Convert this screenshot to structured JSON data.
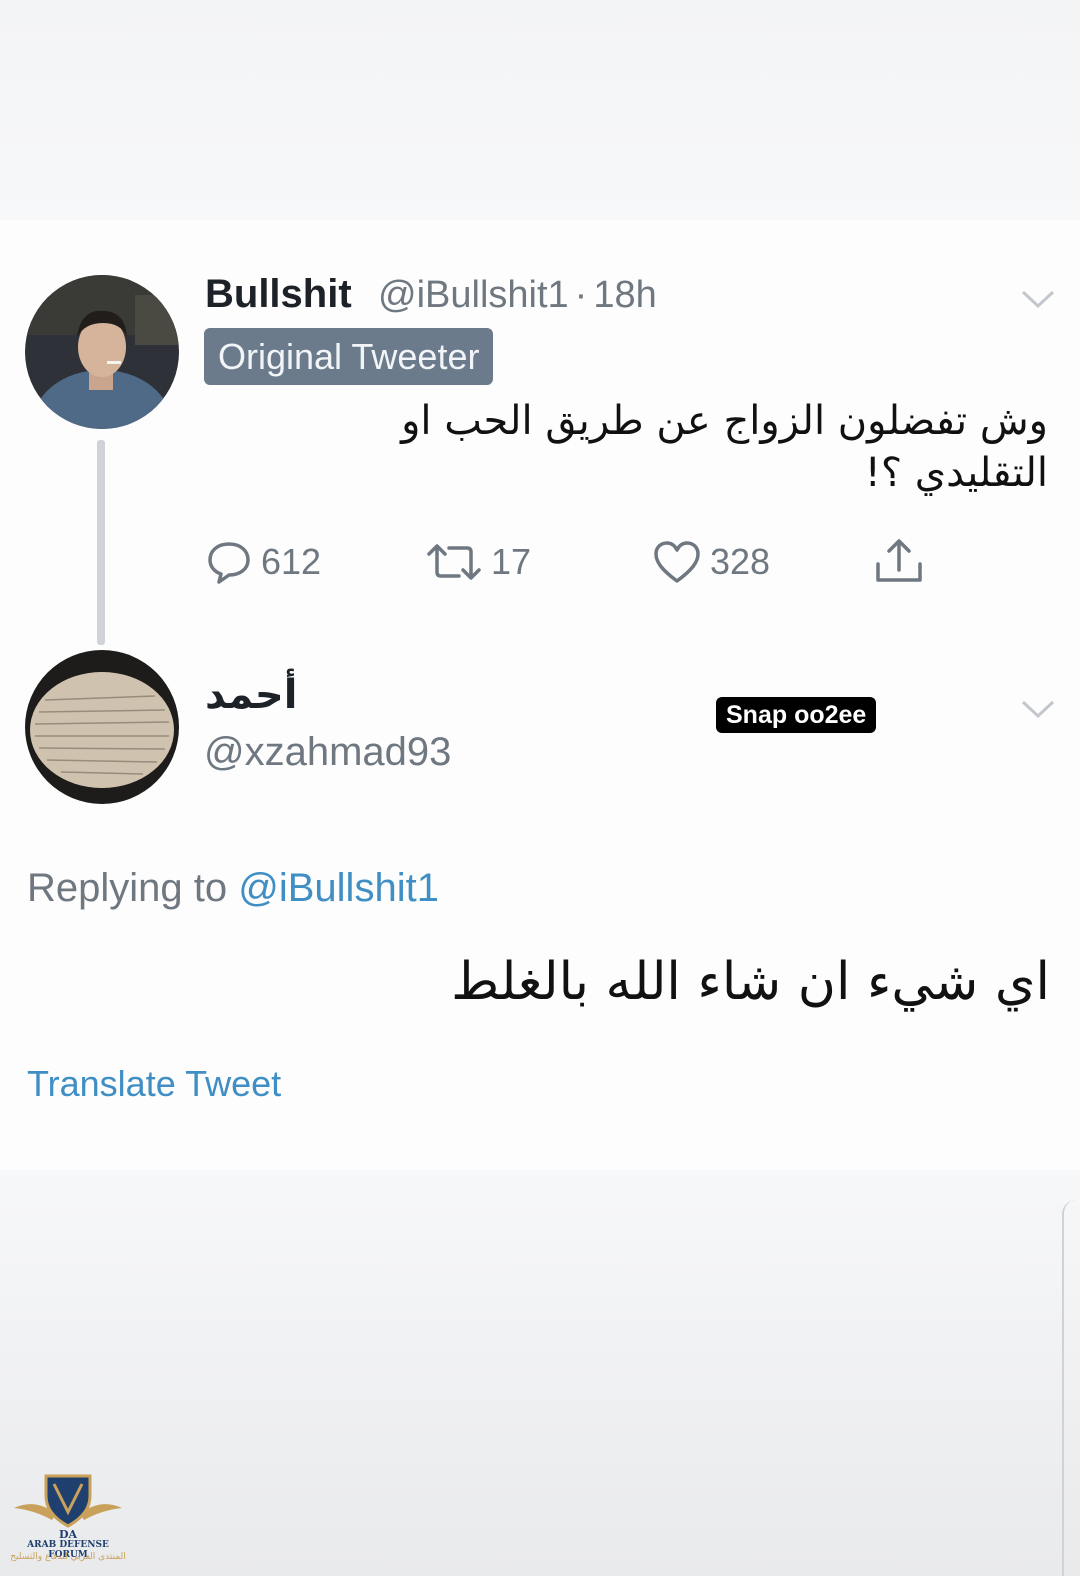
{
  "tweet1": {
    "display_name": "Bullshit",
    "handle": "@iBullshit1",
    "separator": "·",
    "time": "18h",
    "badge": "Original Tweeter",
    "text": "وش تفضلون الزواج عن طريق الحب او التقليدي ؟!",
    "replies": "612",
    "retweets": "17",
    "likes": "328"
  },
  "tweet2": {
    "display_name": "أحمد",
    "handle": "@xzahmad93",
    "overlay_sticker": "Snap oo2ee",
    "replying_label": "Replying to",
    "replying_mention": "@iBullshit1",
    "text": "اي شيء ان شاء الله بالغلط",
    "translate_label": "Translate Tweet"
  },
  "watermark": {
    "title": "ARAB DEFENSE FORUM",
    "subtitle": "المنتدى العربي للدفاع والتسليح",
    "initials": "DA"
  },
  "icons": {
    "reply": "reply-bubble-icon",
    "retweet": "retweet-icon",
    "like": "heart-icon",
    "share": "share-icon",
    "more": "chevron-down-icon"
  },
  "colors": {
    "link": "#3f8ec4",
    "badge_bg": "#6b7b8c",
    "muted": "#6f7780"
  }
}
